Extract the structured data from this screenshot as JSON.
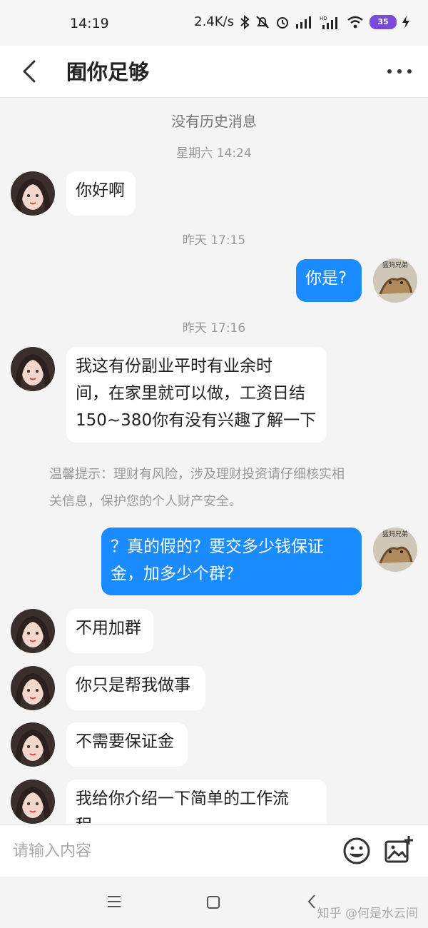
{
  "status": {
    "time": "14:19",
    "speed": "2.4K/s",
    "battery": "35"
  },
  "header": {
    "title": "囿你足够"
  },
  "history_note": "没有历史消息",
  "timestamps": [
    "星期六 14:24",
    "昨天 17:15",
    "昨天 17:16"
  ],
  "messages": [
    {
      "from": "them",
      "lines": [
        "你好啊"
      ]
    },
    {
      "from": "me",
      "lines": [
        "你是?"
      ]
    },
    {
      "from": "them",
      "lines": [
        "我这有份副业平时有业余时",
        "间，在家里就可以做，工资日结",
        "150~380你有没有兴趣了解一下"
      ]
    },
    {
      "from": "me",
      "lines": [
        "？真的假的？要交多少钱保证",
        "金，加多少个群？"
      ]
    },
    {
      "from": "them",
      "lines": [
        "不用加群"
      ]
    },
    {
      "from": "them",
      "lines": [
        "你只是帮我做事"
      ]
    },
    {
      "from": "them",
      "lines": [
        "不需要保证金"
      ]
    },
    {
      "from": "them",
      "lines": [
        "我给你介绍一下简单的工作流",
        "程"
      ]
    }
  ],
  "tip": {
    "line1": "温馨提示：理财有风险，涉及理财投资请仔细核实相",
    "line2": "关信息，保护您的个人财产安全。"
  },
  "composer": {
    "placeholder": "请输入内容"
  },
  "my_avatar_text": "猛犸兄弟",
  "watermark": "知乎 @何是水云间",
  "icons": {
    "back": "chevron-left-icon",
    "more": "more-icon",
    "emoji": "emoji-icon",
    "image": "image-add-icon"
  },
  "colors": {
    "outgoing": "#1a8cff",
    "incoming": "#ffffff",
    "background": "#f4f4f4"
  }
}
